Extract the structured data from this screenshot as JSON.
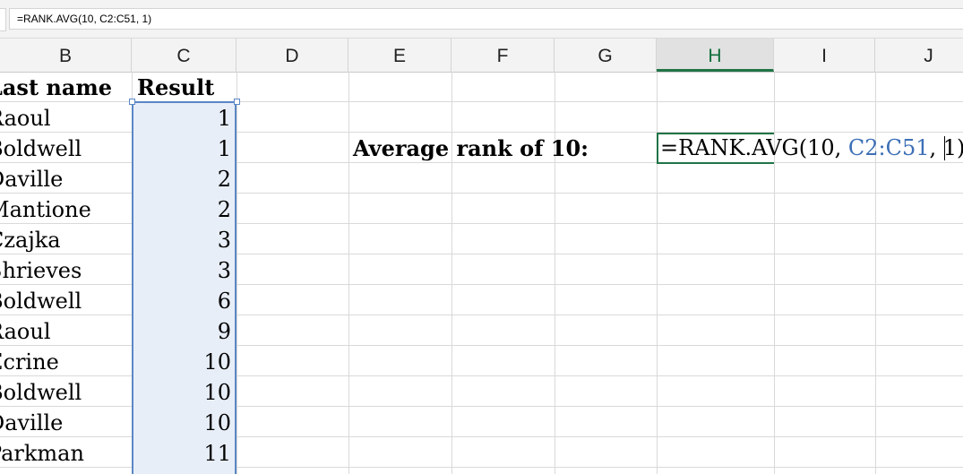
{
  "formula_bar": {
    "formula": "=RANK.AVG(10, C2:C51, 1)"
  },
  "columns": [
    "B",
    "C",
    "D",
    "E",
    "F",
    "G",
    "H",
    "I",
    "J"
  ],
  "active_column": "H",
  "headers": {
    "last_name": "Last name",
    "result": "Result"
  },
  "rows": [
    {
      "last_name": "Raoul",
      "result": "1"
    },
    {
      "last_name": "Boldwell",
      "result": "1"
    },
    {
      "last_name": "Daville",
      "result": "2"
    },
    {
      "last_name": "Mantione",
      "result": "2"
    },
    {
      "last_name": "Czajka",
      "result": "3"
    },
    {
      "last_name": "Shrieves",
      "result": "3"
    },
    {
      "last_name": "Boldwell",
      "result": "6"
    },
    {
      "last_name": "Raoul",
      "result": "9"
    },
    {
      "last_name": "Ecrine",
      "result": "10"
    },
    {
      "last_name": "Boldwell",
      "result": "10"
    },
    {
      "last_name": "Daville",
      "result": "10"
    },
    {
      "last_name": "Parkman",
      "result": "11"
    }
  ],
  "label_e2": "Average rank of 10:",
  "edit_cell": {
    "prefix": "=RANK.AVG(10, ",
    "range_ref": "C2:C51",
    "suffix": ", 1)"
  },
  "colors": {
    "accent": "#217346",
    "selection_fill": "#e8eef8",
    "selection_border": "#5b87c5",
    "ref_text": "#3d6fb6"
  }
}
